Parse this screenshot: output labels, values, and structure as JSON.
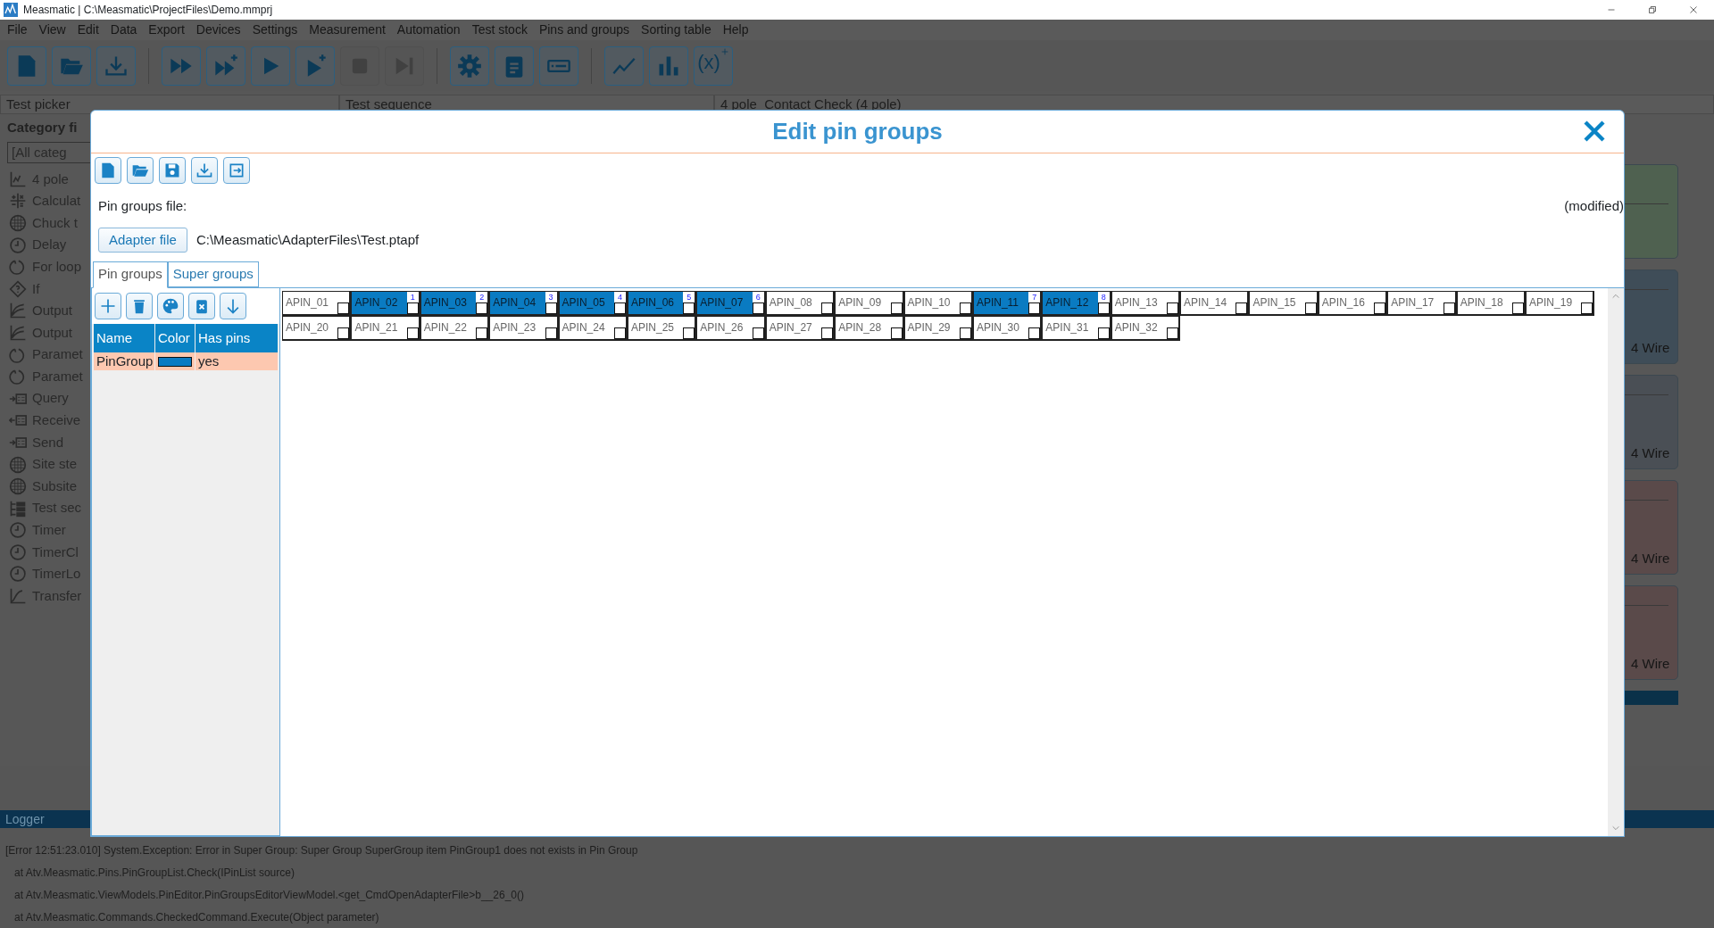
{
  "window": {
    "title": "Measmatic | C:\\Measmatic\\ProjectFiles\\Demo.mmprj"
  },
  "menu": [
    "File",
    "View",
    "Edit",
    "Data",
    "Export",
    "Devices",
    "Settings",
    "Measurement",
    "Automation",
    "Test stock",
    "Pins and groups",
    "Sorting table",
    "Help"
  ],
  "toolbar": [
    [
      {
        "kind": "new",
        "disabled": false
      },
      {
        "kind": "open",
        "disabled": false
      },
      {
        "kind": "import",
        "disabled": false
      }
    ],
    [
      {
        "kind": "run-all",
        "disabled": false
      },
      {
        "kind": "run-all-plus",
        "disabled": false
      },
      {
        "kind": "run",
        "disabled": false
      },
      {
        "kind": "run-plus",
        "disabled": false
      },
      {
        "kind": "stop",
        "disabled": true
      },
      {
        "kind": "step",
        "disabled": true
      }
    ],
    [
      {
        "kind": "gear",
        "disabled": false
      },
      {
        "kind": "clipboard",
        "disabled": false
      },
      {
        "kind": "device",
        "disabled": false
      }
    ],
    [
      {
        "kind": "line-chart",
        "disabled": false
      },
      {
        "kind": "bar-chart",
        "disabled": false
      },
      {
        "kind": "variable",
        "label": "(x)",
        "disabled": false
      }
    ]
  ],
  "test_picker": {
    "title": "Test picker",
    "category_label": "Category fi",
    "category_value": "[All categ",
    "items": [
      {
        "kind": "axes",
        "label": "4 pole"
      },
      {
        "kind": "calc",
        "label": "Calculat"
      },
      {
        "kind": "grid",
        "label": "Chuck t"
      },
      {
        "kind": "clock",
        "label": "Delay"
      },
      {
        "kind": "loop",
        "label": "For loop"
      },
      {
        "kind": "diamond",
        "label": "If"
      },
      {
        "kind": "curve",
        "label": "Output"
      },
      {
        "kind": "curve",
        "label": "Output"
      },
      {
        "kind": "loop",
        "label": "Paramet"
      },
      {
        "kind": "loop",
        "label": "Paramet"
      },
      {
        "kind": "io-in",
        "label": "Query"
      },
      {
        "kind": "io-out",
        "label": "Receive"
      },
      {
        "kind": "io-in",
        "label": "Send"
      },
      {
        "kind": "grid",
        "label": "Site ste"
      },
      {
        "kind": "grid",
        "label": "Subsite"
      },
      {
        "kind": "tree",
        "label": "Test sec"
      },
      {
        "kind": "clock",
        "label": "Timer"
      },
      {
        "kind": "clock",
        "label": "TimerCl"
      },
      {
        "kind": "clock",
        "label": "TimerLo"
      },
      {
        "kind": "transfer",
        "label": "Transfer"
      }
    ]
  },
  "test_sequence": {
    "title": "Test sequence"
  },
  "document": {
    "title": "4 pole_Contact Check (4 pole)",
    "cards": [
      {
        "color": "#4f6150"
      },
      {
        "color": "#3f4d58",
        "label": "4 Wire"
      },
      {
        "color": "#4a4f55",
        "label": "4 Wire"
      },
      {
        "color": "#5a4a4a",
        "label": "4 Wire"
      },
      {
        "color": "#5a4a4a",
        "label": "4 Wire"
      }
    ]
  },
  "logger": {
    "title": "Logger",
    "lines": [
      "[Error 12:51:23.010] System.Exception: Error in Super Group: Super Group SuperGroup item PinGroup1 does not exists in Pin Group",
      "   at Atv.Measmatic.Pins.PinGroupList.Check(IPinList source)",
      "   at Atv.Measmatic.ViewModels.PinEditor.PinGroupsEditorViewModel.<get_CmdOpenAdapterFile>b__26_0()",
      "   at Atv.Measmatic.Commands.CheckedCommand.Execute(Object parameter)"
    ]
  },
  "dialog": {
    "title": "Edit pin groups",
    "toolbar": [
      {
        "kind": "new"
      },
      {
        "kind": "open"
      },
      {
        "kind": "save"
      },
      {
        "kind": "import"
      },
      {
        "kind": "export"
      }
    ],
    "file_label": "Pin groups file:",
    "status": "(modified)",
    "adapter_button": "Adapter file",
    "adapter_path": "C:\\Measmatic\\AdapterFiles\\Test.ptapf",
    "tabs": [
      {
        "label": "Pin groups",
        "selected": true
      },
      {
        "label": "Super groups",
        "selected": false
      }
    ],
    "group_toolbar": [
      {
        "kind": "add"
      },
      {
        "kind": "delete"
      },
      {
        "kind": "palette"
      },
      {
        "kind": "clear"
      },
      {
        "kind": "down"
      }
    ],
    "columns": [
      "Name",
      "Color",
      "Has pins"
    ],
    "rows": [
      {
        "name": "PinGroup",
        "color": "#0a7bc2",
        "has_pins": "yes",
        "selected": true
      }
    ],
    "pins": [
      {
        "label": "APIN_01",
        "selected": false
      },
      {
        "label": "APIN_02",
        "selected": true,
        "number": "1"
      },
      {
        "label": "APIN_03",
        "selected": true,
        "number": "2"
      },
      {
        "label": "APIN_04",
        "selected": true,
        "number": "3"
      },
      {
        "label": "APIN_05",
        "selected": true,
        "number": "4"
      },
      {
        "label": "APIN_06",
        "selected": true,
        "number": "5"
      },
      {
        "label": "APIN_07",
        "selected": true,
        "number": "6"
      },
      {
        "label": "APIN_08",
        "selected": false
      },
      {
        "label": "APIN_09",
        "selected": false
      },
      {
        "label": "APIN_10",
        "selected": false
      },
      {
        "label": "APIN_11",
        "selected": true,
        "number": "7"
      },
      {
        "label": "APIN_12",
        "selected": true,
        "number": "8"
      },
      {
        "label": "APIN_13",
        "selected": false
      },
      {
        "label": "APIN_14",
        "selected": false
      },
      {
        "label": "APIN_15",
        "selected": false
      },
      {
        "label": "APIN_16",
        "selected": false
      },
      {
        "label": "APIN_17",
        "selected": false
      },
      {
        "label": "APIN_18",
        "selected": false
      },
      {
        "label": "APIN_19",
        "selected": false
      },
      {
        "label": "APIN_20",
        "selected": false
      },
      {
        "label": "APIN_21",
        "selected": false
      },
      {
        "label": "APIN_22",
        "selected": false
      },
      {
        "label": "APIN_23",
        "selected": false
      },
      {
        "label": "APIN_24",
        "selected": false
      },
      {
        "label": "APIN_25",
        "selected": false
      },
      {
        "label": "APIN_26",
        "selected": false
      },
      {
        "label": "APIN_27",
        "selected": false
      },
      {
        "label": "APIN_28",
        "selected": false
      },
      {
        "label": "APIN_29",
        "selected": false
      },
      {
        "label": "APIN_30",
        "selected": false
      },
      {
        "label": "APIN_31",
        "selected": false
      },
      {
        "label": "APIN_32",
        "selected": false
      }
    ]
  }
}
